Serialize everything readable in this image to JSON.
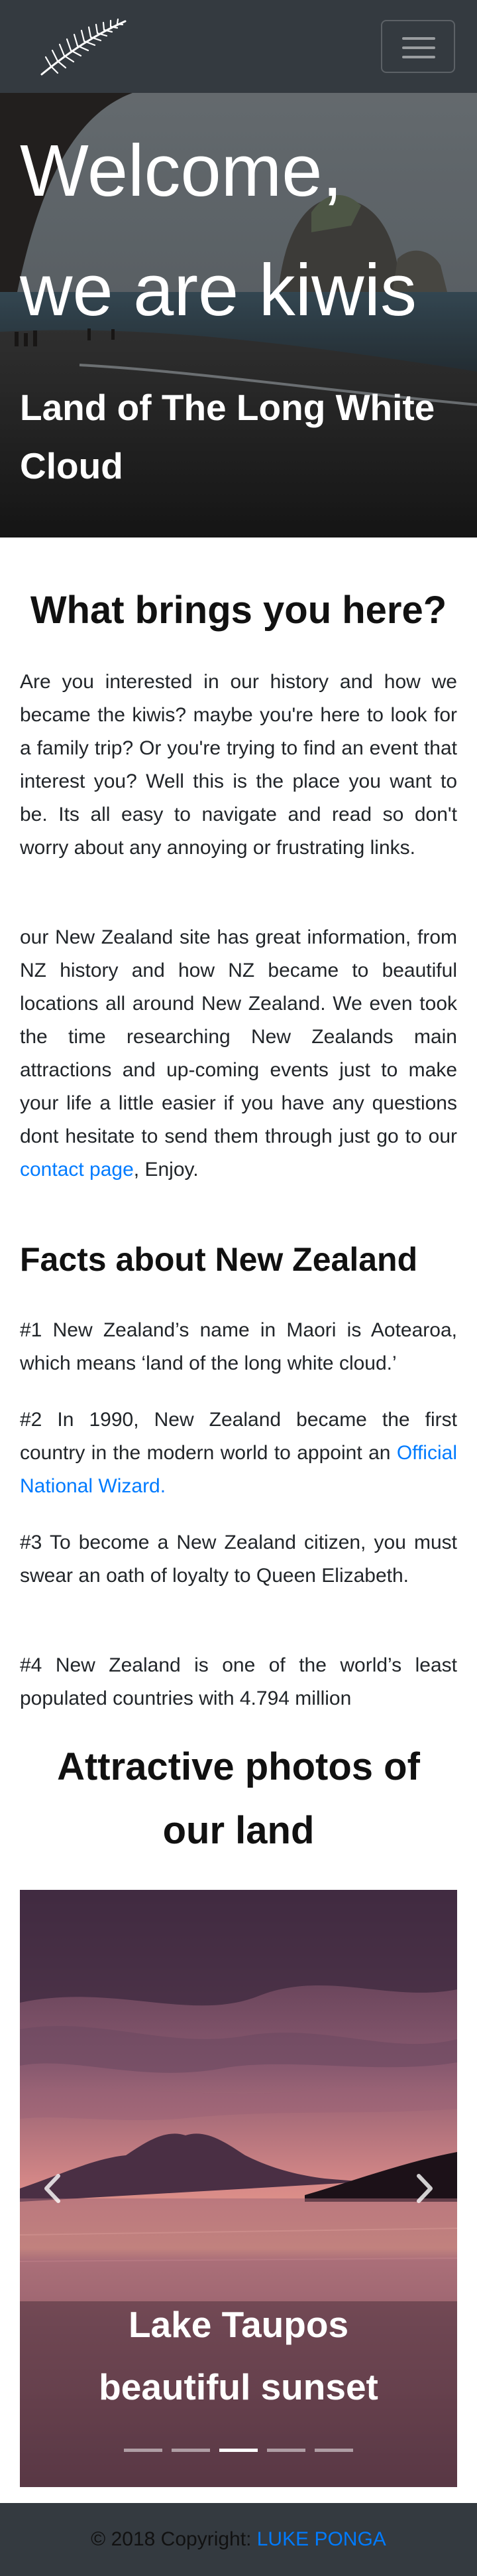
{
  "navbar": {
    "logo_icon": "silver-fern-icon",
    "menu_icon": "hamburger-menu-icon",
    "bg_color": "#343a40"
  },
  "hero": {
    "title_line1": "Welcome,",
    "title_line2": "we are kiwis",
    "subtitle_line1": "Land of The Long White",
    "subtitle_line2": "Cloud"
  },
  "intro": {
    "heading": "What brings you here?",
    "paragraph1": "Are you interested in our history and how we became the kiwis? maybe you're here to look for a family trip? Or you're trying to find an event that interest you? Well this is the place you want to be. Its all easy to navigate and read so don't worry about any annoying or frustrating links.",
    "paragraph2_before": "our New Zealand site has great information, from NZ history and how NZ became to beautiful locations all around New Zealand. We even took the time researching New Zealands main attractions and up-coming events just to make your life a little easier if you have any questions dont hesitate to send them through just go to our ",
    "paragraph2_link": "contact page",
    "paragraph2_after": ", Enjoy."
  },
  "facts": {
    "heading": "Facts about New Zealand",
    "fact1": "#1 New Zealand’s name in Maori is Aotearoa, which means ‘land of the long white cloud.’",
    "fact2_before": "#2 In 1990, New Zealand became the first country in the modern world to appoint an ",
    "fact2_link": "Official National Wizard.",
    "fact3": "#3 To become a New Zealand citizen, you must swear an oath of loyalty to Queen Elizabeth.",
    "fact4": "#4 New Zealand is one of the world’s least populated countries with 4.794 million"
  },
  "photos": {
    "heading_line1": "Attractive photos of",
    "heading_line2": "our land",
    "caption_line1": "Lake Taupos",
    "caption_line2": "beautiful sunset",
    "prev_icon": "chevron-left-icon",
    "next_icon": "chevron-right-icon",
    "slide_count": 5,
    "active_slide_index": 2
  },
  "footer": {
    "copyright": "© 2018 Copyright: ",
    "author_link": "LUKE PONGA"
  },
  "colors": {
    "link": "#007bff",
    "dark": "#343a40"
  }
}
